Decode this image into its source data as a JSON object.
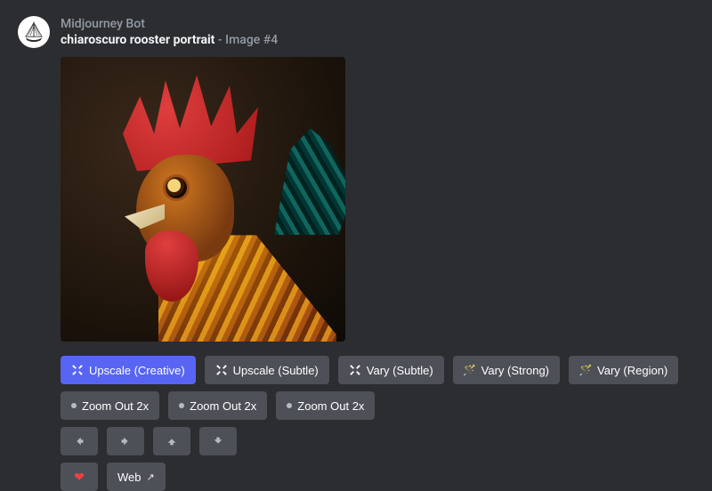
{
  "header": {
    "bot_name": "Midjourney Bot",
    "prompt": "chiaroscuro rooster portrait",
    "image_suffix": "- Image #4"
  },
  "row1": [
    {
      "label": "Upscale (Creative)",
      "icon": "expand-icon",
      "primary": true
    },
    {
      "label": "Upscale (Subtle)",
      "icon": "expand-icon",
      "primary": false
    },
    {
      "label": "Vary (Subtle)",
      "icon": "expand-icon",
      "primary": false
    },
    {
      "label": "Vary (Strong)",
      "icon": "wand-icon",
      "primary": false
    },
    {
      "label": "Vary (Region)",
      "icon": "wand-icon",
      "primary": false
    }
  ],
  "row2": [
    {
      "label": "Zoom Out 2x",
      "icon": "dot-icon"
    },
    {
      "label": "Zoom Out 2x",
      "icon": "dot-icon"
    },
    {
      "label": "Zoom Out 2x",
      "icon": "dot-icon"
    }
  ],
  "row3_arrows": [
    "left",
    "right",
    "up",
    "down"
  ],
  "row4": {
    "web_label": "Web"
  }
}
